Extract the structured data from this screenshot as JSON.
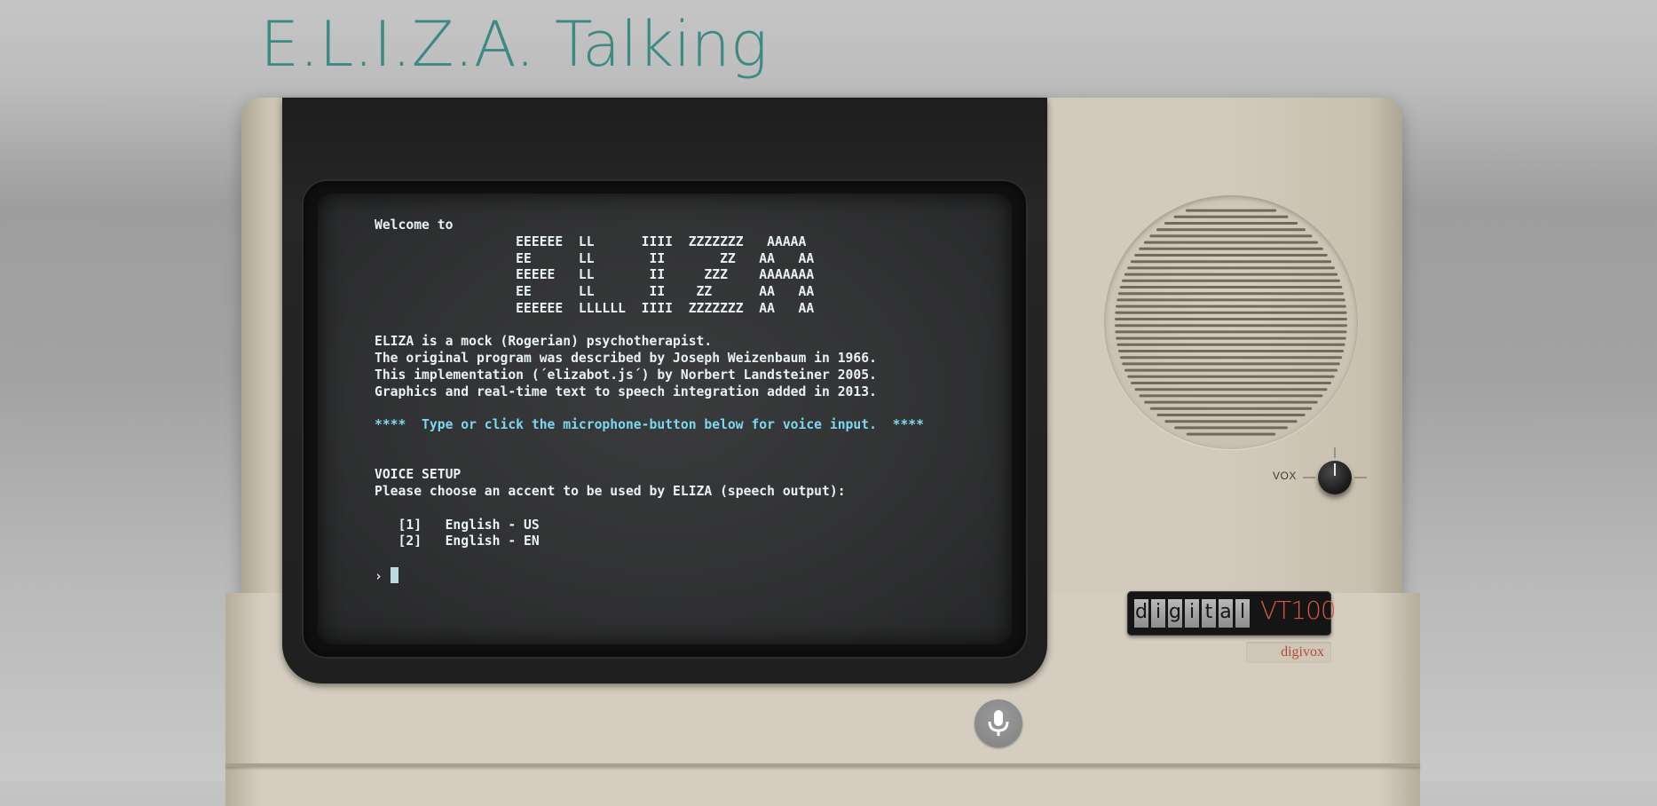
{
  "header": {
    "title": "E.L.I.Z.A. Talking"
  },
  "screen": {
    "lines": [
      {
        "text": "Welcome to",
        "tone": "normal"
      },
      {
        "text": "                  EEEEEE  LL      IIII  ZZZZZZZ   AAAAA",
        "tone": "normal"
      },
      {
        "text": "                  EE      LL       II       ZZ   AA   AA",
        "tone": "normal"
      },
      {
        "text": "                  EEEEE   LL       II     ZZZ    AAAAAAA",
        "tone": "normal"
      },
      {
        "text": "                  EE      LL       II    ZZ      AA   AA",
        "tone": "normal"
      },
      {
        "text": "                  EEEEEE  LLLLLL  IIII  ZZZZZZZ  AA   AA",
        "tone": "normal"
      },
      {
        "text": "",
        "tone": "normal"
      },
      {
        "text": "ELIZA is a mock (Rogerian) psychotherapist.",
        "tone": "normal"
      },
      {
        "text": "The original program was described by Joseph Weizenbaum in 1966.",
        "tone": "normal"
      },
      {
        "text": "This implementation (´elizabot.js´) by Norbert Landsteiner 2005.",
        "tone": "normal"
      },
      {
        "text": "Graphics and real-time text to speech integration added in 2013.",
        "tone": "normal"
      },
      {
        "text": "",
        "tone": "normal"
      },
      {
        "text": "****  Type or click the microphone-button below for voice input.  ****",
        "tone": "highlight"
      },
      {
        "text": "",
        "tone": "normal"
      },
      {
        "text": "",
        "tone": "normal"
      },
      {
        "text": "VOICE SETUP",
        "tone": "normal"
      },
      {
        "text": "Please choose an accent to be used by ELIZA (speech output):",
        "tone": "normal"
      },
      {
        "text": "",
        "tone": "normal"
      },
      {
        "text": "   [1]   English - US",
        "tone": "option"
      },
      {
        "text": "   [2]   English - EN",
        "tone": "option"
      },
      {
        "text": "",
        "tone": "normal"
      }
    ],
    "prompt": "›",
    "input_value": ""
  },
  "controls": {
    "vox_label": "VOX",
    "mic_icon": "microphone-icon"
  },
  "branding": {
    "logo_letters": [
      "d",
      "i",
      "g",
      "i",
      "t",
      "a",
      "l"
    ],
    "model": "VT100",
    "sub_badge": "digivox"
  },
  "colors": {
    "title": "#3b8a83",
    "screen_text": "#e8f2f6",
    "screen_highlight": "#7cd8f0",
    "model_text": "#d8563f",
    "sub_badge_text": "#b8483a"
  }
}
